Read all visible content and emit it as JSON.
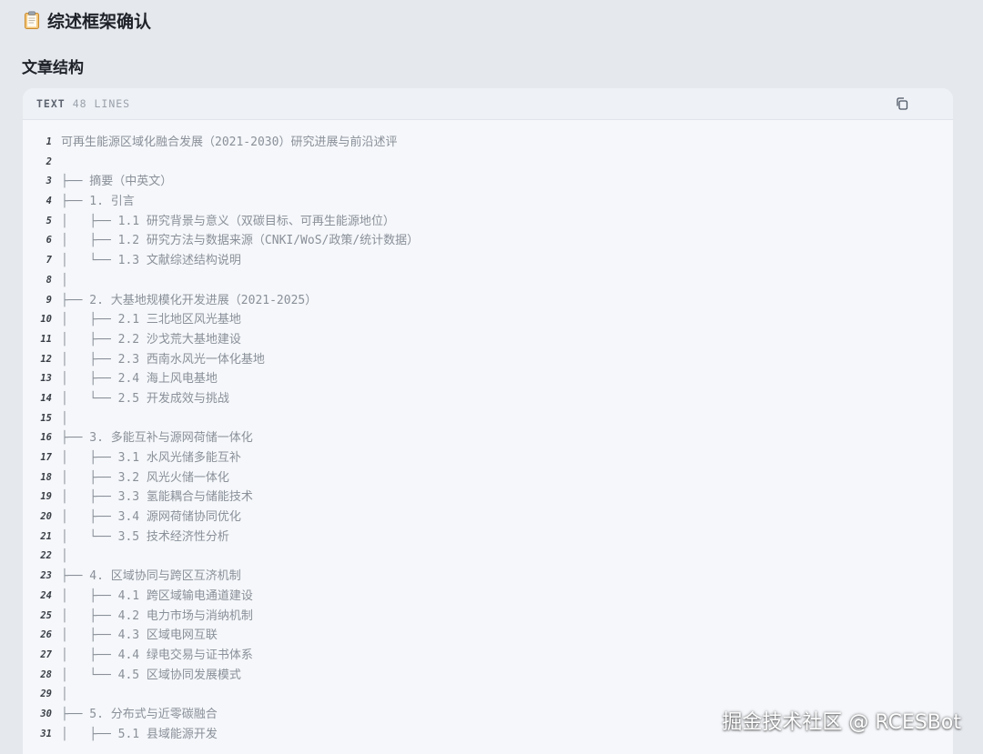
{
  "header": {
    "title": "综述框架确认",
    "icon": "clipboard-icon"
  },
  "section": {
    "title": "文章结构"
  },
  "code_block": {
    "language": "TEXT",
    "line_count_label": "48 LINES",
    "copy_icon": "copy-icon",
    "lines": [
      {
        "n": "1",
        "t": "可再生能源区域化融合发展（2021-2030）研究进展与前沿述评"
      },
      {
        "n": "2",
        "t": ""
      },
      {
        "n": "3",
        "t": "├── 摘要（中英文）"
      },
      {
        "n": "4",
        "t": "├── 1. 引言"
      },
      {
        "n": "5",
        "t": "│   ├── 1.1 研究背景与意义（双碳目标、可再生能源地位）"
      },
      {
        "n": "6",
        "t": "│   ├── 1.2 研究方法与数据来源（CNKI/WoS/政策/统计数据）"
      },
      {
        "n": "7",
        "t": "│   └── 1.3 文献综述结构说明"
      },
      {
        "n": "8",
        "t": "│"
      },
      {
        "n": "9",
        "t": "├── 2. 大基地规模化开发进展（2021-2025）"
      },
      {
        "n": "10",
        "t": "│   ├── 2.1 三北地区风光基地"
      },
      {
        "n": "11",
        "t": "│   ├── 2.2 沙戈荒大基地建设"
      },
      {
        "n": "12",
        "t": "│   ├── 2.3 西南水风光一体化基地"
      },
      {
        "n": "13",
        "t": "│   ├── 2.4 海上风电基地"
      },
      {
        "n": "14",
        "t": "│   └── 2.5 开发成效与挑战"
      },
      {
        "n": "15",
        "t": "│"
      },
      {
        "n": "16",
        "t": "├── 3. 多能互补与源网荷储一体化"
      },
      {
        "n": "17",
        "t": "│   ├── 3.1 水风光储多能互补"
      },
      {
        "n": "18",
        "t": "│   ├── 3.2 风光火储一体化"
      },
      {
        "n": "19",
        "t": "│   ├── 3.3 氢能耦合与储能技术"
      },
      {
        "n": "20",
        "t": "│   ├── 3.4 源网荷储协同优化"
      },
      {
        "n": "21",
        "t": "│   └── 3.5 技术经济性分析"
      },
      {
        "n": "22",
        "t": "│"
      },
      {
        "n": "23",
        "t": "├── 4. 区域协同与跨区互济机制"
      },
      {
        "n": "24",
        "t": "│   ├── 4.1 跨区域输电通道建设"
      },
      {
        "n": "25",
        "t": "│   ├── 4.2 电力市场与消纳机制"
      },
      {
        "n": "26",
        "t": "│   ├── 4.3 区域电网互联"
      },
      {
        "n": "27",
        "t": "│   ├── 4.4 绿电交易与证书体系"
      },
      {
        "n": "28",
        "t": "│   └── 4.5 区域协同发展模式"
      },
      {
        "n": "29",
        "t": "│"
      },
      {
        "n": "30",
        "t": "├── 5. 分布式与近零碳融合"
      },
      {
        "n": "31",
        "t": "│   ├── 5.1 县域能源开发"
      }
    ]
  },
  "watermark": {
    "text": "掘金技术社区 @ RCESBot"
  }
}
